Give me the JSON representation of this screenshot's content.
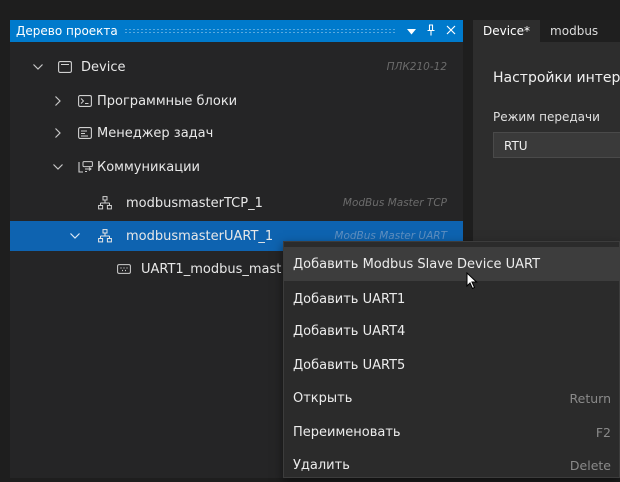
{
  "panel": {
    "title": "Дерево проекта",
    "header_buttons": [
      "dropdown-icon",
      "pin-icon",
      "close-icon"
    ]
  },
  "tree": {
    "device": {
      "label": "Device",
      "type": "ПЛК210-12"
    },
    "program_blocks": {
      "label": "Программные блоки"
    },
    "task_manager": {
      "label": "Менеджер задач"
    },
    "communications": {
      "label": "Коммуникации"
    },
    "modbus_tcp": {
      "label": "modbusmasterTCP_1",
      "type": "ModBus Master TCP"
    },
    "modbus_uart": {
      "label": "modbusmasterUART_1",
      "type": "ModBus Master UART"
    },
    "uart1_slave": {
      "label": "UART1_modbus_mast"
    }
  },
  "tabs": [
    "Device*",
    "modbus"
  ],
  "settings": {
    "heading": "Настройки интер",
    "mode_label": "Режим передачи",
    "mode_value": "RTU"
  },
  "context_menu": {
    "items": [
      {
        "label": "Добавить Modbus Slave Device UART",
        "shortcut": ""
      },
      {
        "label": "Добавить UART1",
        "shortcut": ""
      },
      {
        "label": "Добавить UART4",
        "shortcut": ""
      },
      {
        "label": "Добавить UART5",
        "shortcut": ""
      },
      {
        "label": "Открыть",
        "shortcut": "Return"
      },
      {
        "label": "Переименовать",
        "shortcut": "F2"
      },
      {
        "label": "Удалить",
        "shortcut": "Delete"
      }
    ]
  },
  "colors": {
    "accent": "#007acc",
    "selection": "#0e63b0",
    "panel_bg": "#252526",
    "menu_bg": "#2b2b2b"
  }
}
